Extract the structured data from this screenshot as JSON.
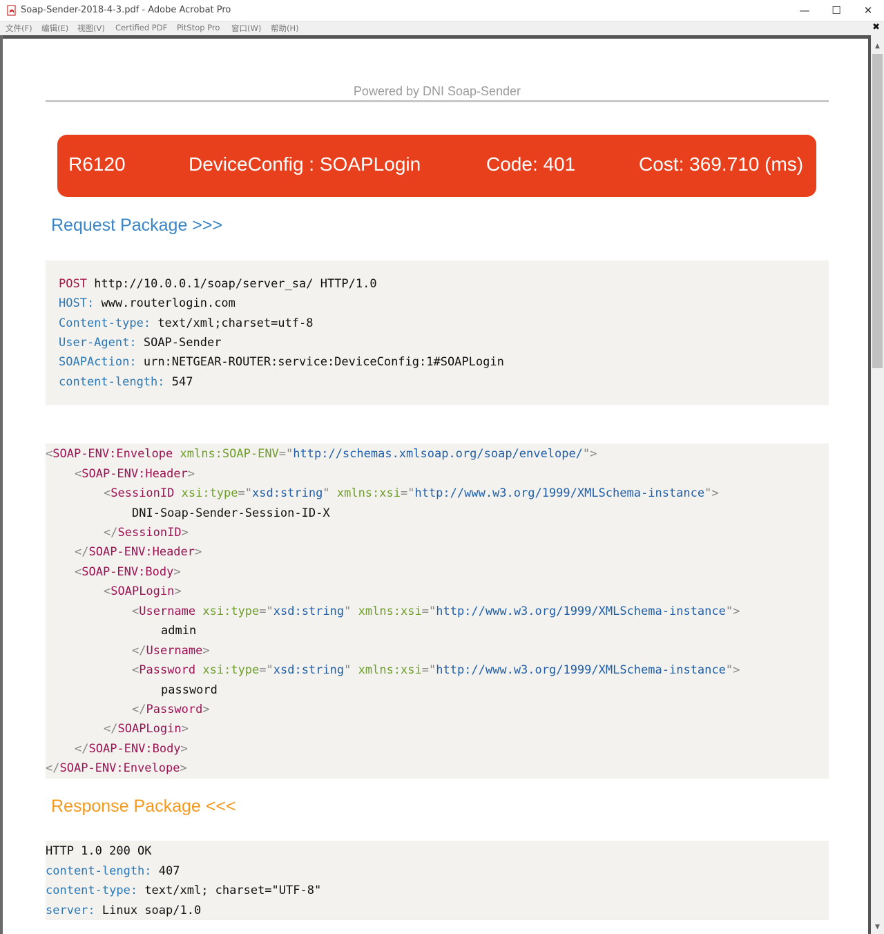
{
  "window": {
    "title": "Soap-Sender-2018-4-3.pdf - Adobe Acrobat Pro",
    "controls": {
      "minimize": "—",
      "maximize": "☐",
      "close": "✕"
    }
  },
  "menu": {
    "items": [
      "文件(F)",
      "编辑(E)",
      "视图(V)",
      "Certified PDF",
      "PitStop Pro",
      "窗口(W)",
      "帮助(H)"
    ],
    "close_glyph": "✖"
  },
  "page": {
    "powered_by": "Powered by DNI Soap-Sender",
    "status": {
      "model": "R6120",
      "action": "DeviceConfig : SOAPLogin",
      "code": "Code: 401",
      "cost": "Cost: 369.710 (ms)",
      "color": "#e8401d"
    },
    "request_heading": "Request Package >>>",
    "request_headers": {
      "method": "POST",
      "request_line": "http://10.0.0.1/soap/server_sa/ HTTP/1.0",
      "fields": [
        {
          "name": "HOST:",
          "value": "www.routerlogin.com"
        },
        {
          "name": "Content-type:",
          "value": "text/xml;charset=utf-8"
        },
        {
          "name": "User-Agent:",
          "value": "SOAP-Sender"
        },
        {
          "name": "SOAPAction:",
          "value": "urn:NETGEAR-ROUTER:service:DeviceConfig:1#SOAPLogin"
        },
        {
          "name": "content-length:",
          "value": "547"
        }
      ]
    },
    "xml": {
      "envelope_tag": "SOAP-ENV:Envelope",
      "envelope_attr": "xmlns:SOAP-ENV",
      "envelope_ns": "http://schemas.xmlsoap.org/soap/envelope/",
      "header_tag": "SOAP-ENV:Header",
      "session_tag": "SessionID",
      "type_attr": "xsi:type",
      "type_val": "xsd:string",
      "xsi_attr": "xmlns:xsi",
      "xsi_ns": "http://www.w3.org/1999/XMLSchema-instance",
      "session_value": "DNI-Soap-Sender-Session-ID-X",
      "body_tag": "SOAP-ENV:Body",
      "login_tag": "SOAPLogin",
      "username_tag": "Username",
      "username_value": "admin",
      "password_tag": "Password",
      "password_value": "password"
    },
    "response_heading": "Response Package <<<",
    "response_headers": {
      "status_line": "HTTP 1.0 200 OK",
      "fields": [
        {
          "name": "content-length:",
          "value": "407"
        },
        {
          "name": "content-type:",
          "value": "text/xml; charset=\"UTF-8\""
        },
        {
          "name": "server:",
          "value": "Linux soap/1.0"
        }
      ]
    }
  },
  "scrollbar": {
    "up": "▲",
    "down": "▼"
  }
}
